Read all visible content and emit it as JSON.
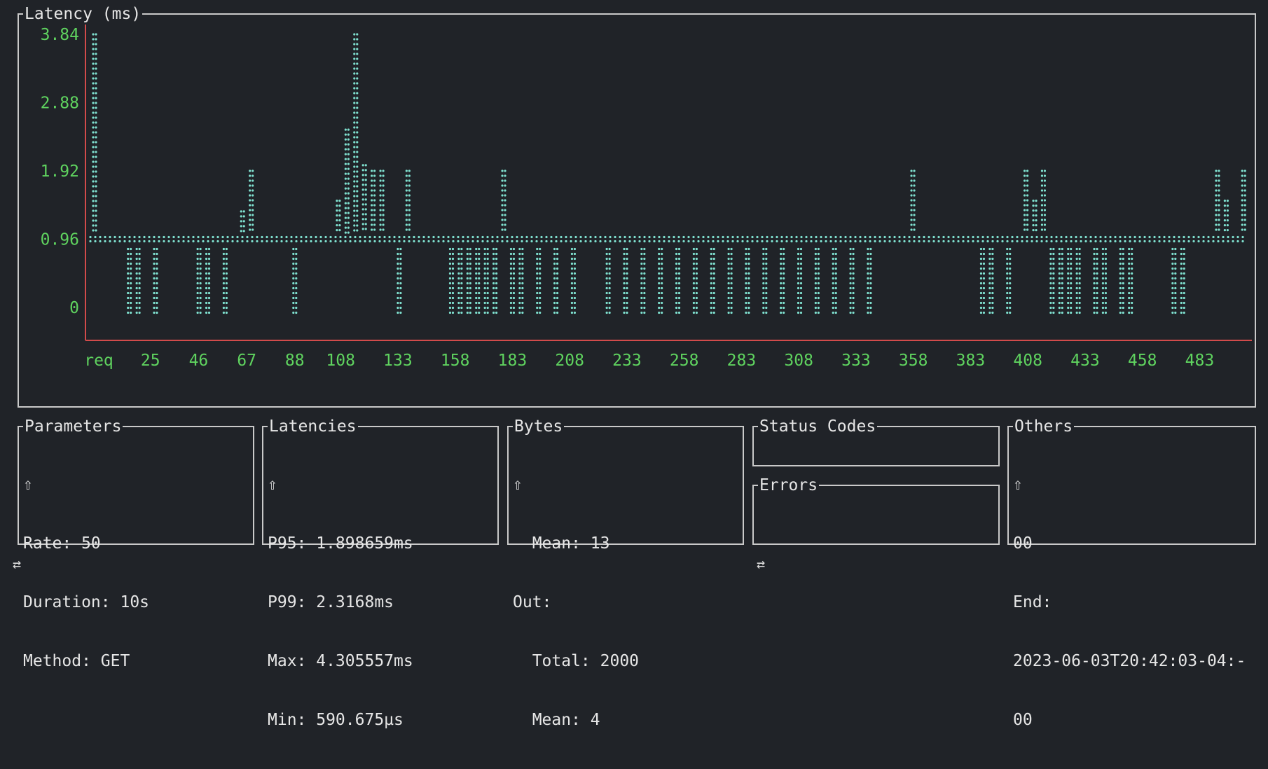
{
  "chart": {
    "title": "Latency (ms)"
  },
  "chart_data": {
    "type": "bar",
    "title": "Latency (ms)",
    "xlabel": "req",
    "ylabel": "",
    "x_ticks": [
      "req",
      "25",
      "46",
      "67",
      "88",
      "108",
      "133",
      "158",
      "183",
      "208",
      "233",
      "258",
      "283",
      "308",
      "333",
      "358",
      "383",
      "408",
      "433",
      "458",
      "483"
    ],
    "y_ticks": [
      "3.84",
      "2.88",
      "1.92",
      "0.96",
      "0"
    ],
    "y_tick_values": [
      3.84,
      2.88,
      1.92,
      0.96,
      0
    ],
    "ylim": [
      0,
      3.84
    ],
    "xlim": [
      0,
      500
    ],
    "baseline": 0.96,
    "grid": false,
    "colors": {
      "marks": "#7fe0cf",
      "ticks": "#5fd35f",
      "axis": "#d24b4b"
    },
    "bars_x_step": 5,
    "values": [
      3.84,
      0.96,
      0.96,
      0.96,
      0.55,
      0.55,
      0.96,
      0.55,
      0.96,
      0.96,
      0.96,
      0.96,
      0.55,
      0.55,
      0.96,
      0.55,
      0.96,
      1.35,
      1.92,
      0.96,
      0.96,
      0.96,
      0.96,
      0.55,
      0.96,
      0.96,
      0.96,
      0.96,
      1.5,
      2.5,
      3.84,
      2.0,
      1.92,
      1.92,
      1.0,
      0.55,
      1.92,
      0.96,
      0.96,
      0.96,
      0.96,
      0.55,
      0.55,
      0.55,
      0.55,
      0.55,
      0.55,
      1.92,
      0.55,
      0.55,
      0.96,
      0.55,
      0.96,
      0.55,
      0.96,
      0.55,
      0.96,
      0.96,
      0.96,
      0.55,
      0.96,
      0.55,
      0.96,
      0.55,
      0.96,
      0.55,
      0.96,
      0.55,
      0.96,
      0.55,
      0.96,
      0.55,
      0.96,
      0.55,
      0.96,
      0.55,
      0.96,
      0.55,
      0.96,
      0.55,
      0.96,
      0.55,
      0.96,
      0.55,
      0.96,
      0.55,
      0.96,
      0.55,
      0.96,
      0.55,
      0.96,
      0.96,
      0.96,
      0.96,
      1.92,
      0.96,
      0.96,
      0.96,
      0.96,
      0.96,
      0.96,
      0.96,
      0.55,
      0.55,
      0.96,
      0.55,
      0.96,
      1.92,
      1.5,
      1.92,
      0.55,
      0.55,
      0.55,
      0.55,
      0.96,
      0.55,
      0.55,
      0.96,
      0.55,
      0.55,
      0.96,
      0.96,
      0.96,
      0.96,
      0.55,
      0.55,
      0.96,
      0.96,
      0.96,
      1.92,
      1.5,
      0.96,
      1.92
    ]
  },
  "panels": {
    "parameters": {
      "title": "Parameters",
      "lines": [
        "⇧",
        "Rate: 50",
        "Duration: 10s",
        "Method: GET"
      ]
    },
    "latencies": {
      "title": "Latencies",
      "lines": [
        "⇧",
        "P95: 1.898659ms",
        "P99: 2.3168ms",
        "Max: 4.305557ms",
        "Min: 590.675µs"
      ]
    },
    "bytes": {
      "title": "Bytes",
      "lines": [
        "⇧",
        "  Mean: 13",
        "Out:",
        "  Total: 2000",
        "  Mean: 4"
      ]
    },
    "status_codes": {
      "title": "Status Codes"
    },
    "errors": {
      "title": "Errors"
    },
    "others": {
      "title": "Others",
      "lines": [
        "⇧",
        "00",
        "End:",
        "2023-06-03T20:42:03-04:-",
        "00"
      ]
    }
  },
  "footer": {
    "left_icon": "⇄",
    "right_icon": "⇄"
  }
}
